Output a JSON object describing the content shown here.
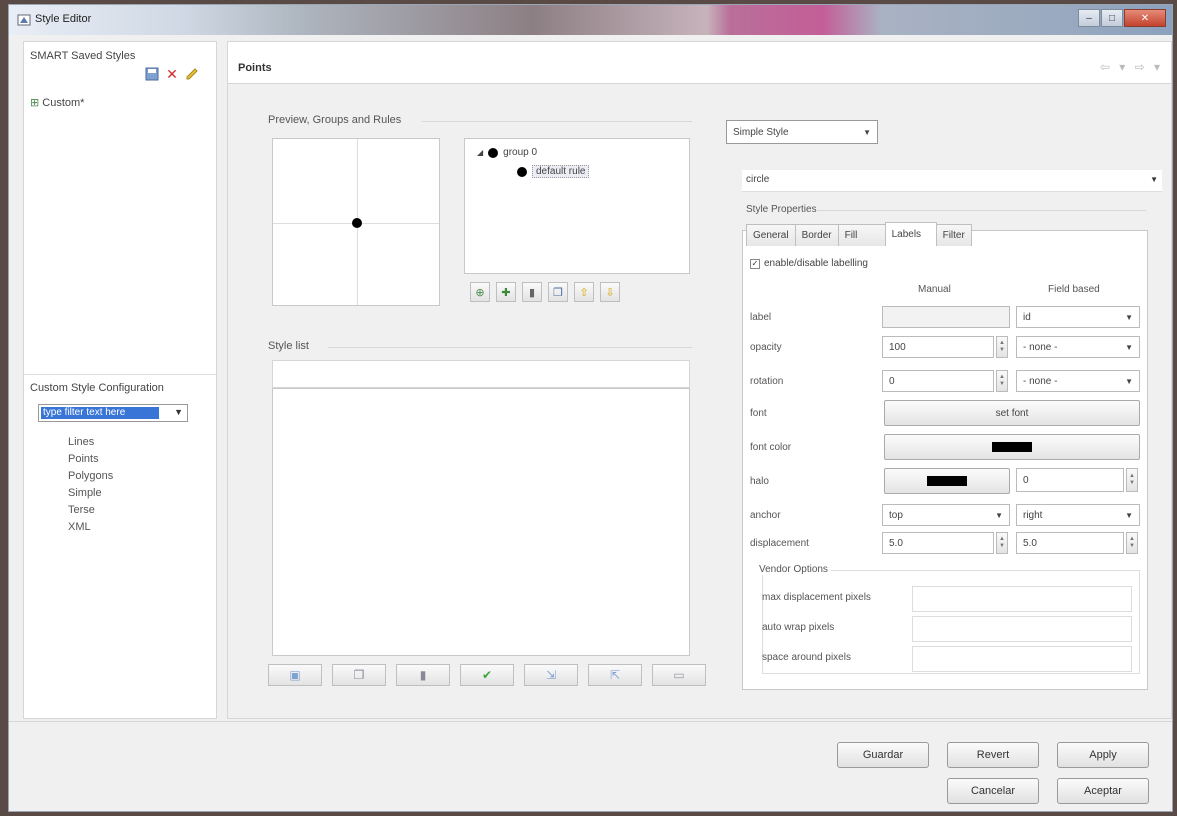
{
  "window": {
    "title": "Style Editor"
  },
  "left": {
    "saved_title": "SMART Saved Styles",
    "saved_items": [
      "Custom*"
    ],
    "config_title": "Custom Style Configuration",
    "filter_placeholder": "type filter text here",
    "config_items": [
      "Lines",
      "Points",
      "Polygons",
      "Simple",
      "Terse",
      "XML"
    ]
  },
  "main": {
    "title": "Points",
    "preview_label": "Preview, Groups and Rules",
    "group_label": "group 0",
    "rule_label": "default rule",
    "style_list_label": "Style list"
  },
  "right": {
    "style_mode": "Simple Style",
    "shape": "circle",
    "props_title": "Style Properties",
    "tabs": [
      "General",
      "Border",
      "Fill",
      "Labels",
      "Filter"
    ],
    "active_tab": "Labels",
    "enable_label": "enable/disable labelling",
    "col_manual": "Manual",
    "col_field": "Field based",
    "rows": {
      "label": "label",
      "label_field": "id",
      "opacity": "opacity",
      "opacity_val": "100",
      "opacity_field": "- none -",
      "rotation": "rotation",
      "rotation_val": "0",
      "rotation_field": "- none -",
      "font": "font",
      "font_btn": "set font",
      "font_color": "font color",
      "halo": "halo",
      "halo_val": "0",
      "anchor": "anchor",
      "anchor_v": "top",
      "anchor_h": "right",
      "displacement": "displacement",
      "disp_x": "5.0",
      "disp_y": "5.0"
    },
    "vendor_title": "Vendor Options",
    "vendor_rows": [
      "max displacement pixels",
      "auto wrap pixels",
      "space around pixels"
    ]
  },
  "buttons": {
    "guardar": "Guardar",
    "revert": "Revert",
    "apply": "Apply",
    "cancelar": "Cancelar",
    "aceptar": "Aceptar"
  }
}
